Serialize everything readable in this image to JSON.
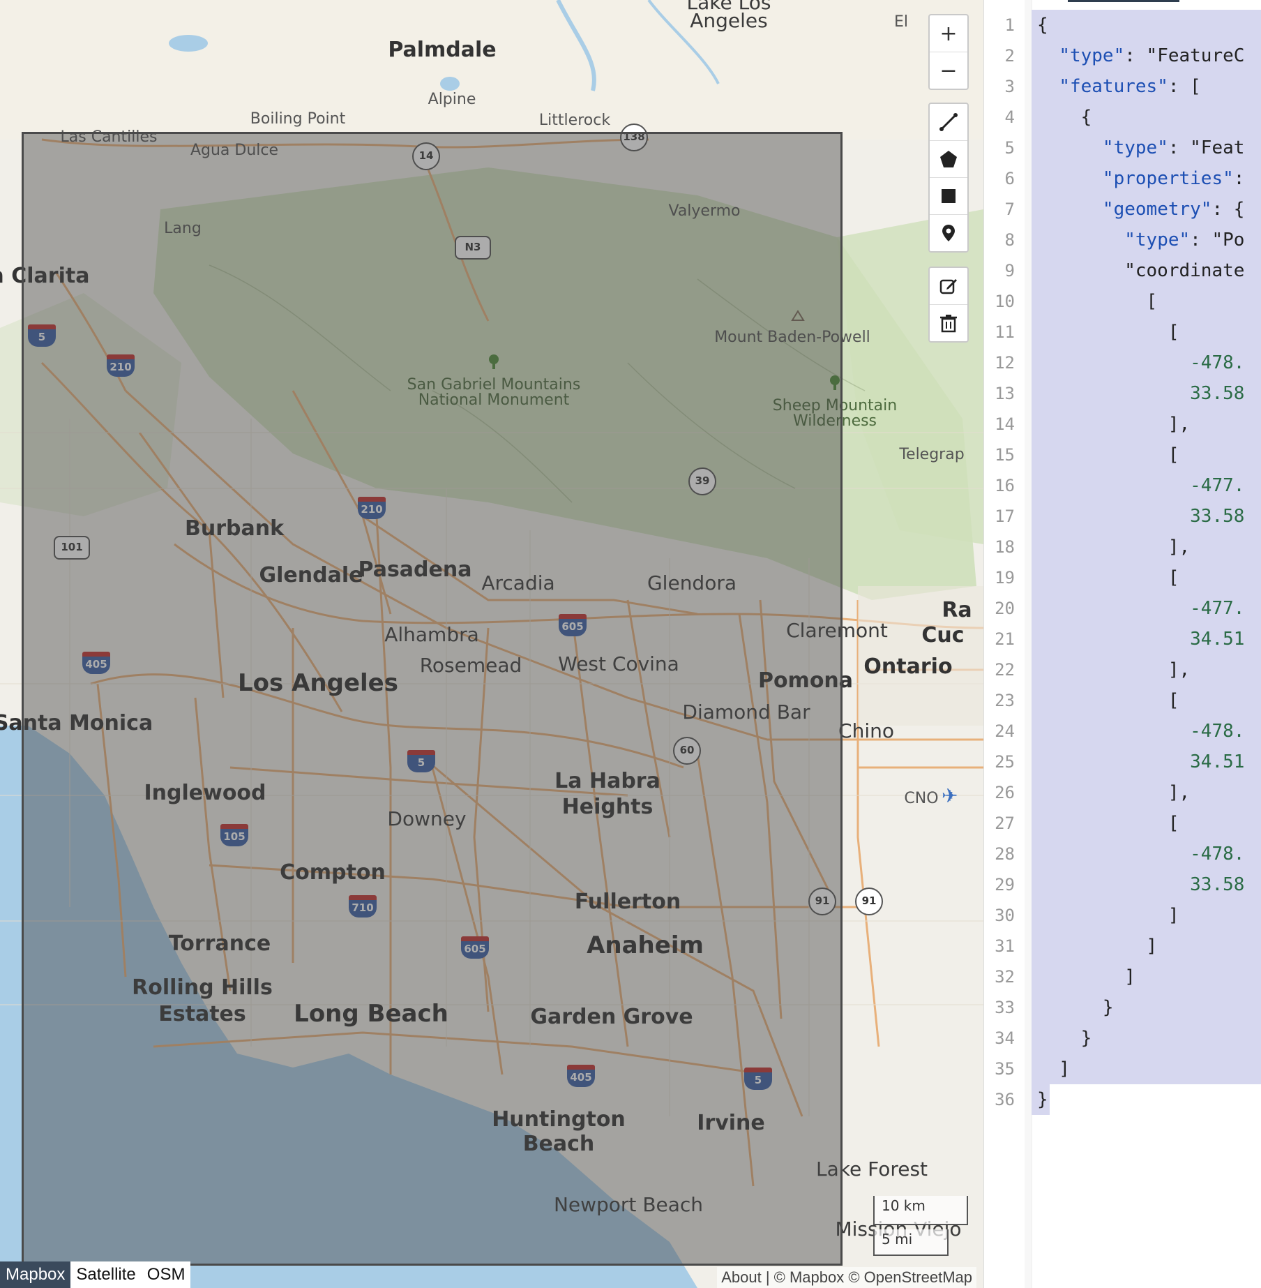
{
  "map": {
    "places": [
      {
        "name": "Lake Los",
        "cls": "city-m"
      },
      {
        "name": "Angeles",
        "cls": "city-m"
      },
      {
        "name": "Palmdale",
        "cls": "city-l"
      },
      {
        "name": "Alpine",
        "cls": "city-s"
      },
      {
        "name": "Boiling Point",
        "cls": "city-s"
      },
      {
        "name": "Littlerock",
        "cls": "city-s"
      },
      {
        "name": "Las Cantilles",
        "cls": "city-s"
      },
      {
        "name": "Agua Dulce",
        "cls": "city-s"
      },
      {
        "name": "Valyermo",
        "cls": "city-s"
      },
      {
        "name": "Lang",
        "cls": "city-s"
      },
      {
        "name": "a Clarita",
        "cls": "city-l"
      },
      {
        "name": "Mount Baden-Powell",
        "cls": "city-s"
      },
      {
        "name": "San Gabriel Mountains\nNational Monument",
        "cls": "park"
      },
      {
        "name": "Sheep Mountain\nWilderness",
        "cls": "park"
      },
      {
        "name": "Telegrap",
        "cls": "city-s"
      },
      {
        "name": "Burbank",
        "cls": "city-l"
      },
      {
        "name": "Glendale",
        "cls": "city-l"
      },
      {
        "name": "Pasadena",
        "cls": "city-l"
      },
      {
        "name": "Arcadia",
        "cls": "city-m"
      },
      {
        "name": "Glendora",
        "cls": "city-m"
      },
      {
        "name": "Claremont",
        "cls": "city-m"
      },
      {
        "name": "Alhambra",
        "cls": "city-m"
      },
      {
        "name": "Rosemead",
        "cls": "city-m"
      },
      {
        "name": "West Covina",
        "cls": "city-m"
      },
      {
        "name": "Ontario",
        "cls": "city-l"
      },
      {
        "name": "Los Angeles",
        "cls": "city-xl"
      },
      {
        "name": "Pomona",
        "cls": "city-l"
      },
      {
        "name": "Diamond Bar",
        "cls": "city-m"
      },
      {
        "name": "Chino",
        "cls": "city-m"
      },
      {
        "name": "Santa Monica",
        "cls": "city-l"
      },
      {
        "name": "CNO",
        "cls": "city-s"
      },
      {
        "name": "Inglewood",
        "cls": "city-l"
      },
      {
        "name": "La Habra",
        "cls": "city-l"
      },
      {
        "name": "Heights",
        "cls": "city-l"
      },
      {
        "name": "Downey",
        "cls": "city-m"
      },
      {
        "name": "Compton",
        "cls": "city-l"
      },
      {
        "name": "Fullerton",
        "cls": "city-l"
      },
      {
        "name": "Torrance",
        "cls": "city-l"
      },
      {
        "name": "Anaheim",
        "cls": "city-xl"
      },
      {
        "name": "Rolling Hills",
        "cls": "city-l"
      },
      {
        "name": "Estates",
        "cls": "city-l"
      },
      {
        "name": "Long Beach",
        "cls": "city-xl"
      },
      {
        "name": "Garden Grove",
        "cls": "city-l"
      },
      {
        "name": "Huntington",
        "cls": "city-l"
      },
      {
        "name": "Beach",
        "cls": "city-l"
      },
      {
        "name": "Irvine",
        "cls": "city-l"
      },
      {
        "name": "Lake Forest",
        "cls": "city-m"
      },
      {
        "name": "Newport Beach",
        "cls": "city-m"
      },
      {
        "name": "Mission Viejo",
        "cls": "city-m"
      },
      {
        "name": "Ra",
        "cls": "city-l"
      },
      {
        "name": "Cuc",
        "cls": "city-l"
      },
      {
        "name": "El",
        "cls": "city-s"
      }
    ],
    "shields": [
      {
        "num": "14",
        "kind": "state"
      },
      {
        "num": "138",
        "kind": "state"
      },
      {
        "num": "N3",
        "kind": "us"
      },
      {
        "num": "5",
        "kind": "interstate"
      },
      {
        "num": "210",
        "kind": "interstate"
      },
      {
        "num": "210",
        "kind": "interstate"
      },
      {
        "num": "101",
        "kind": "us"
      },
      {
        "num": "39",
        "kind": "state"
      },
      {
        "num": "605",
        "kind": "interstate"
      },
      {
        "num": "405",
        "kind": "interstate"
      },
      {
        "num": "5",
        "kind": "interstate"
      },
      {
        "num": "60",
        "kind": "state"
      },
      {
        "num": "105",
        "kind": "interstate"
      },
      {
        "num": "710",
        "kind": "interstate"
      },
      {
        "num": "605",
        "kind": "interstate"
      },
      {
        "num": "91",
        "kind": "state"
      },
      {
        "num": "91",
        "kind": "state"
      },
      {
        "num": "405",
        "kind": "interstate"
      },
      {
        "num": "5",
        "kind": "interstate"
      }
    ],
    "controls": {
      "zoom_in": "+",
      "zoom_out": "−"
    },
    "scale": {
      "km": "10 km",
      "mi": "5 mi"
    },
    "layers": [
      {
        "label": "Mapbox",
        "active": true
      },
      {
        "label": "Satellite",
        "active": false
      },
      {
        "label": "OSM",
        "active": false
      }
    ],
    "attribution": "About | © Mapbox © OpenStreetMap"
  },
  "editor": {
    "lines": [
      "{",
      "  \"type\": \"FeatureC",
      "  \"features\": [",
      "    {",
      "      \"type\": \"Feat",
      "      \"properties\":",
      "      \"geometry\": {",
      "        \"type\": \"Po",
      "        \"coordinate",
      "          [",
      "            [",
      "              -478.",
      "              33.58",
      "            ],",
      "            [",
      "              -477.",
      "              33.58",
      "            ],",
      "            [",
      "              -477.",
      "              34.51",
      "            ],",
      "            [",
      "              -478.",
      "              34.51",
      "            ],",
      "            [",
      "              -478.",
      "              33.58",
      "            ]",
      "          ]",
      "        ]",
      "      }",
      "    }",
      "  ]",
      "}"
    ]
  },
  "colors": {
    "water": "#a9cde6",
    "land": "#f1efe9",
    "park": "#c7dcb0",
    "road": "#e8b07a",
    "json_key": "#1d4fb3",
    "json_number": "#2a6b45",
    "selection": "#d6d7ef"
  }
}
